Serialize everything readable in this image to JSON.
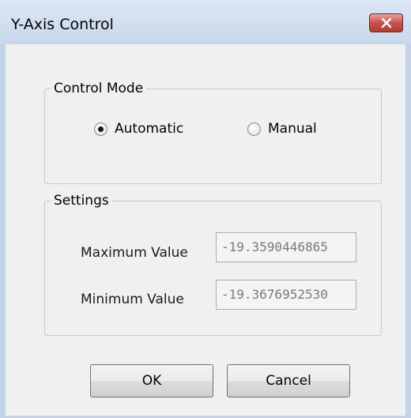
{
  "window": {
    "title": "Y-Axis Control",
    "close_icon": "close-x-icon"
  },
  "control_mode": {
    "legend": "Control Mode",
    "options": [
      {
        "label": "Automatic",
        "selected": true
      },
      {
        "label": "Manual",
        "selected": false
      }
    ]
  },
  "settings": {
    "legend": "Settings",
    "maximum_label": "Maximum Value",
    "maximum_value": "-19.3590446865",
    "minimum_label": "Minimum Value",
    "minimum_value": "-19.3676952530"
  },
  "buttons": {
    "ok": "OK",
    "cancel": "Cancel"
  },
  "colors": {
    "close_button": "#c75050",
    "window_frame": "#c3d4e8",
    "client_background": "#f0f0f0"
  }
}
